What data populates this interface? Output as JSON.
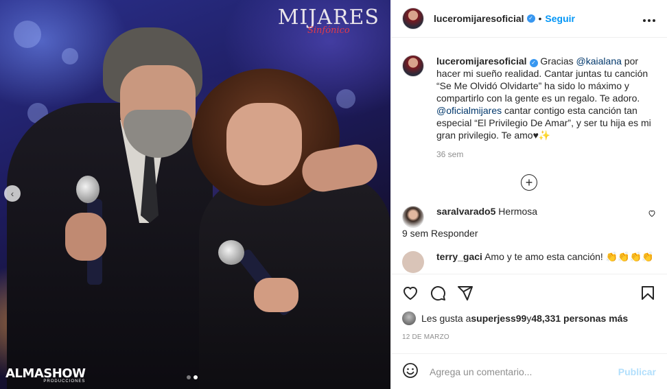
{
  "photo": {
    "brand_top_line1": "MIJARES",
    "brand_top_line2": "Sinfónico",
    "brand_bottom_line1": "ALMASHOW",
    "brand_bottom_line2": "PRODUCCIONES",
    "prev_icon": "chevron-left-icon",
    "carousel": {
      "total": 2,
      "active": 2
    }
  },
  "header": {
    "username": "luceromijaresoficial",
    "separator": "•",
    "follow_label": "Seguir",
    "more_icon": "more-icon"
  },
  "caption": {
    "username": "luceromijaresoficial",
    "part1": " Gracias ",
    "mention1": "@kaialana",
    "part2": " por hacer mi sueño realidad. Cantar juntas tu canción “Se Me Olvidó Olvidarte” ha sido lo máximo y compartirlo con la gente es un regalo. Te adoro. ",
    "mention2": "@oficialmijares",
    "part3": " cantar contigo esta canción tan especial “El Privilegio De Amar”, y ser tu hija es mi gran privilegio. Te amo♥✨",
    "time": "36 sem"
  },
  "load_more_icon": "plus-circle-icon",
  "comments": [
    {
      "username": "saralvarado5",
      "text": "Hermosa",
      "time": "9 sem",
      "reply_label": "Responder"
    }
  ],
  "partial_comment": {
    "username": "terry_gaci",
    "text": "Amo y te amo esta canción! 👏👏👏👏"
  },
  "actions": {
    "like_icon": "heart-icon",
    "comment_icon": "comment-icon",
    "share_icon": "share-icon",
    "save_icon": "bookmark-icon"
  },
  "likes": {
    "prefix": "Les gusta a ",
    "user": "superjess99",
    "middle": " y ",
    "count": "48,331 personas más"
  },
  "date": "12 DE MARZO",
  "add_comment": {
    "emoji_icon": "emoji-icon",
    "placeholder": "Agrega un comentario...",
    "publish_label": "Publicar"
  },
  "colors": {
    "accent": "#0095f6",
    "mention": "#00376b",
    "muted": "#8e8e8e",
    "publish_disabled": "#b2dffc"
  }
}
